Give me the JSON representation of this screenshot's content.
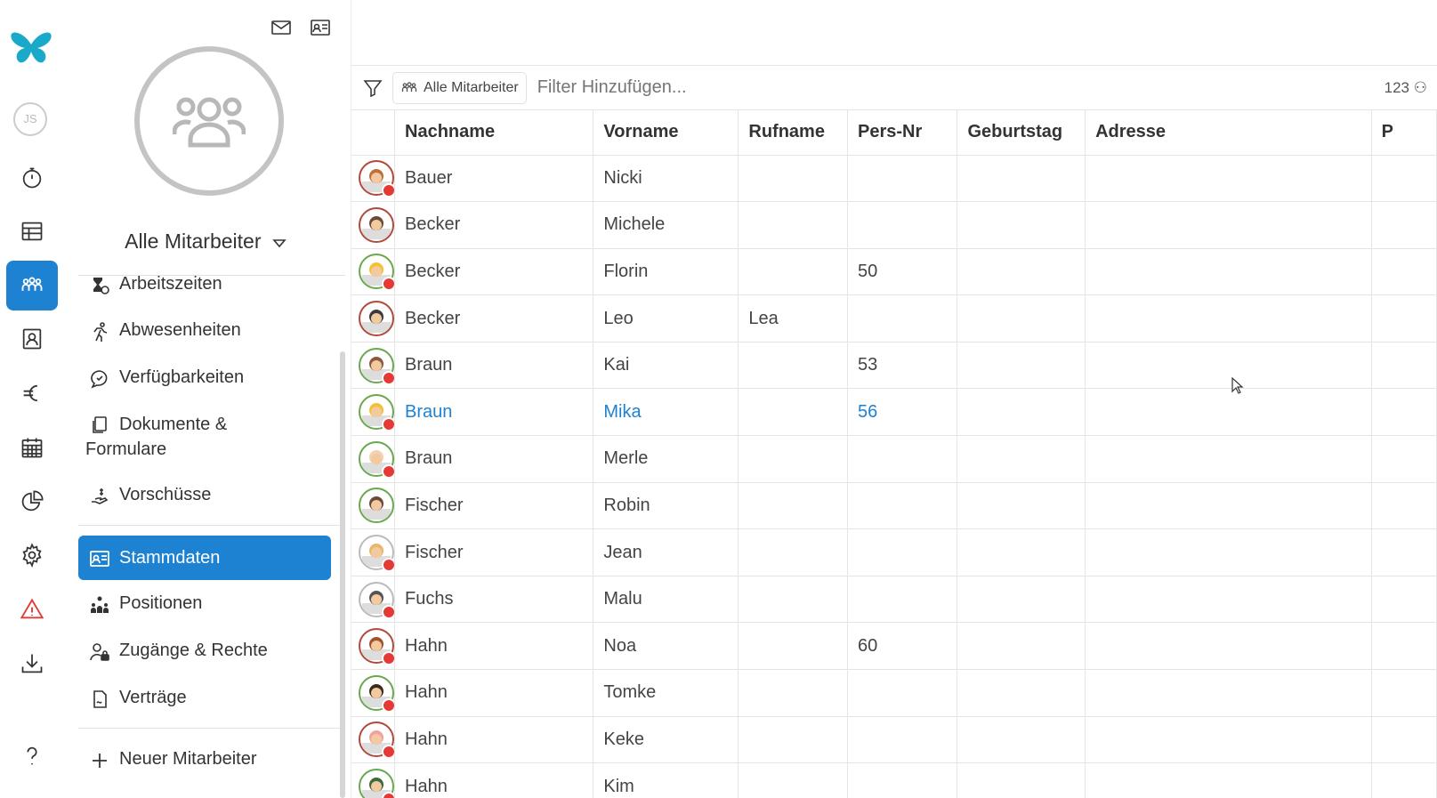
{
  "rail": {
    "avatar_initials": "JS",
    "items": [
      {
        "name": "stopwatch-icon"
      },
      {
        "name": "table-icon"
      },
      {
        "name": "team-icon",
        "active": true
      },
      {
        "name": "contact-card-icon"
      },
      {
        "name": "euro-icon"
      },
      {
        "name": "calendar-icon"
      },
      {
        "name": "pie-chart-icon"
      },
      {
        "name": "gear-icon"
      },
      {
        "name": "warning-icon"
      },
      {
        "name": "download-icon"
      },
      {
        "name": "help-icon"
      }
    ],
    "colors": {
      "active": "#1e82d2",
      "logo": "#1aa9c8",
      "warning": "#e53935"
    }
  },
  "sidebar": {
    "group_name": "Alle Mitarbeiter",
    "items": [
      {
        "label": "Arbeitszeiten",
        "icon": "hourglass-icon"
      },
      {
        "label": "Abwesenheiten",
        "icon": "running-icon"
      },
      {
        "label": "Verfügbarkeiten",
        "icon": "chat-icon"
      },
      {
        "label": "Dokumente &",
        "label2": "Formulare",
        "icon": "documents-icon"
      },
      {
        "label": "Vorschüsse",
        "icon": "hand-money-icon"
      },
      {
        "label": "Stammdaten",
        "icon": "id-card-icon",
        "active": true
      },
      {
        "label": "Positionen",
        "icon": "org-chart-icon"
      },
      {
        "label": "Zugänge & Rechte",
        "icon": "user-lock-icon"
      },
      {
        "label": "Verträge",
        "icon": "contract-icon"
      }
    ],
    "new_employee": "Neuer Mitarbeiter"
  },
  "filter": {
    "chip_label": "Alle Mitarbeiter",
    "placeholder": "Filter Hinzufügen...",
    "count": "123"
  },
  "table": {
    "columns": [
      "Nachname",
      "Vorname",
      "Rufname",
      "Pers-Nr",
      "Geburtstag",
      "Adresse",
      "P"
    ],
    "rows": [
      {
        "nachname": "Bauer",
        "vorname": "Nicki",
        "rufname": "",
        "persnr": "",
        "avatar": "#c0703a",
        "ring": "#b04a3a",
        "badge": true
      },
      {
        "nachname": "Becker",
        "vorname": "Michele",
        "rufname": "",
        "persnr": "",
        "avatar": "#6b4a3a",
        "ring": "#b04a3a",
        "badge": false
      },
      {
        "nachname": "Becker",
        "vorname": "Florin",
        "rufname": "",
        "persnr": "50",
        "avatar": "#f2c230",
        "ring": "#6aa84f",
        "badge": true
      },
      {
        "nachname": "Becker",
        "vorname": "Leo",
        "rufname": "Lea",
        "persnr": "",
        "avatar": "#3b3b3b",
        "ring": "#b04a3a",
        "badge": false
      },
      {
        "nachname": "Braun",
        "vorname": "Kai",
        "rufname": "",
        "persnr": "53",
        "avatar": "#8b5a3a",
        "ring": "#6aa84f",
        "badge": true
      },
      {
        "nachname": "Braun",
        "vorname": "Mika",
        "rufname": "",
        "persnr": "56",
        "avatar": "#f2c230",
        "ring": "#6aa84f",
        "badge": true,
        "selected": true
      },
      {
        "nachname": "Braun",
        "vorname": "Merle",
        "rufname": "",
        "persnr": "",
        "avatar": "#f5d0b5",
        "ring": "#6aa84f",
        "badge": true
      },
      {
        "nachname": "Fischer",
        "vorname": "Robin",
        "rufname": "",
        "persnr": "",
        "avatar": "#6b4a3a",
        "ring": "#6aa84f",
        "badge": false
      },
      {
        "nachname": "Fischer",
        "vorname": "Jean",
        "rufname": "",
        "persnr": "",
        "avatar": "#e8b86a",
        "ring": "#bbbbbb",
        "badge": true
      },
      {
        "nachname": "Fuchs",
        "vorname": "Malu",
        "rufname": "",
        "persnr": "",
        "avatar": "#555555",
        "ring": "#bbbbbb",
        "badge": true
      },
      {
        "nachname": "Hahn",
        "vorname": "Noa",
        "rufname": "",
        "persnr": "60",
        "avatar": "#a0522d",
        "ring": "#b04a3a",
        "badge": true
      },
      {
        "nachname": "Hahn",
        "vorname": "Tomke",
        "rufname": "",
        "persnr": "",
        "avatar": "#3b2a20",
        "ring": "#6aa84f",
        "badge": true
      },
      {
        "nachname": "Hahn",
        "vorname": "Keke",
        "rufname": "",
        "persnr": "",
        "avatar": "#f2a0a0",
        "ring": "#b04a3a",
        "badge": true
      },
      {
        "nachname": "Hahn",
        "vorname": "Kim",
        "rufname": "",
        "persnr": "",
        "avatar": "#3b6b3a",
        "ring": "#6aa84f",
        "badge": true
      }
    ]
  }
}
